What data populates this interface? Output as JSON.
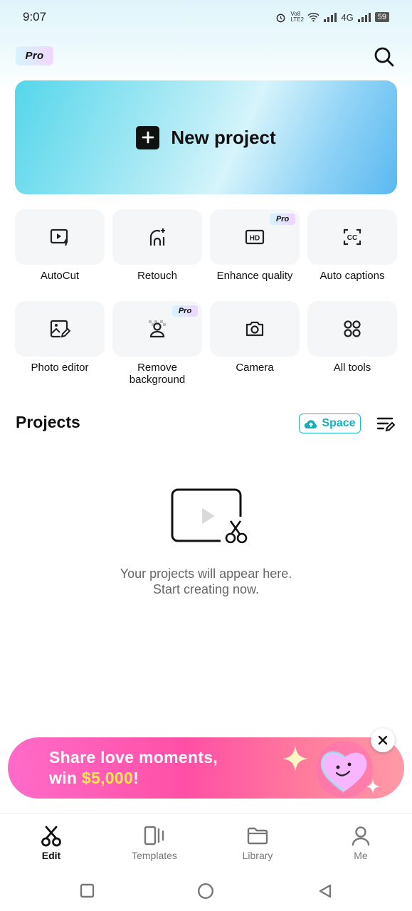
{
  "status_bar": {
    "time": "9:07",
    "network_label": "4G",
    "volte_label": "Vo8 LTE2",
    "battery": "59"
  },
  "header": {
    "pro_badge": "Pro",
    "search_icon": "search-icon"
  },
  "new_project": {
    "label": "New project",
    "icon": "plus-icon"
  },
  "tools": [
    {
      "label": "AutoCut",
      "icon": "autocut-icon",
      "pro": ""
    },
    {
      "label": "Retouch",
      "icon": "retouch-icon",
      "pro": ""
    },
    {
      "label": "Enhance quality",
      "icon": "hd-icon",
      "pro": "Pro"
    },
    {
      "label": "Auto captions",
      "icon": "captions-icon",
      "pro": ""
    },
    {
      "label": "Photo editor",
      "icon": "photo-editor-icon",
      "pro": ""
    },
    {
      "label": "Remove background",
      "icon": "remove-background-icon",
      "pro": "Pro"
    },
    {
      "label": "Camera",
      "icon": "camera-icon",
      "pro": ""
    },
    {
      "label": "All tools",
      "icon": "grid-icon",
      "pro": ""
    }
  ],
  "projects": {
    "title": "Projects",
    "space_button": "Space",
    "empty_line1": "Your projects will appear here.",
    "empty_line2": "Start creating now."
  },
  "promo": {
    "line1": "Share love moments,",
    "line2_prefix": "win ",
    "line2_amount": "$5,000",
    "line2_suffix": "!"
  },
  "bottom_nav": {
    "items": [
      {
        "label": "Edit",
        "icon": "scissors-icon",
        "active": true
      },
      {
        "label": "Templates",
        "icon": "templates-icon",
        "active": false
      },
      {
        "label": "Library",
        "icon": "folder-icon",
        "active": false
      },
      {
        "label": "Me",
        "icon": "person-icon",
        "active": false
      }
    ]
  },
  "colors": {
    "accent": "#14aebf",
    "promo_pink": "#ff4fa5",
    "promo_yellow": "#ffe94a"
  }
}
